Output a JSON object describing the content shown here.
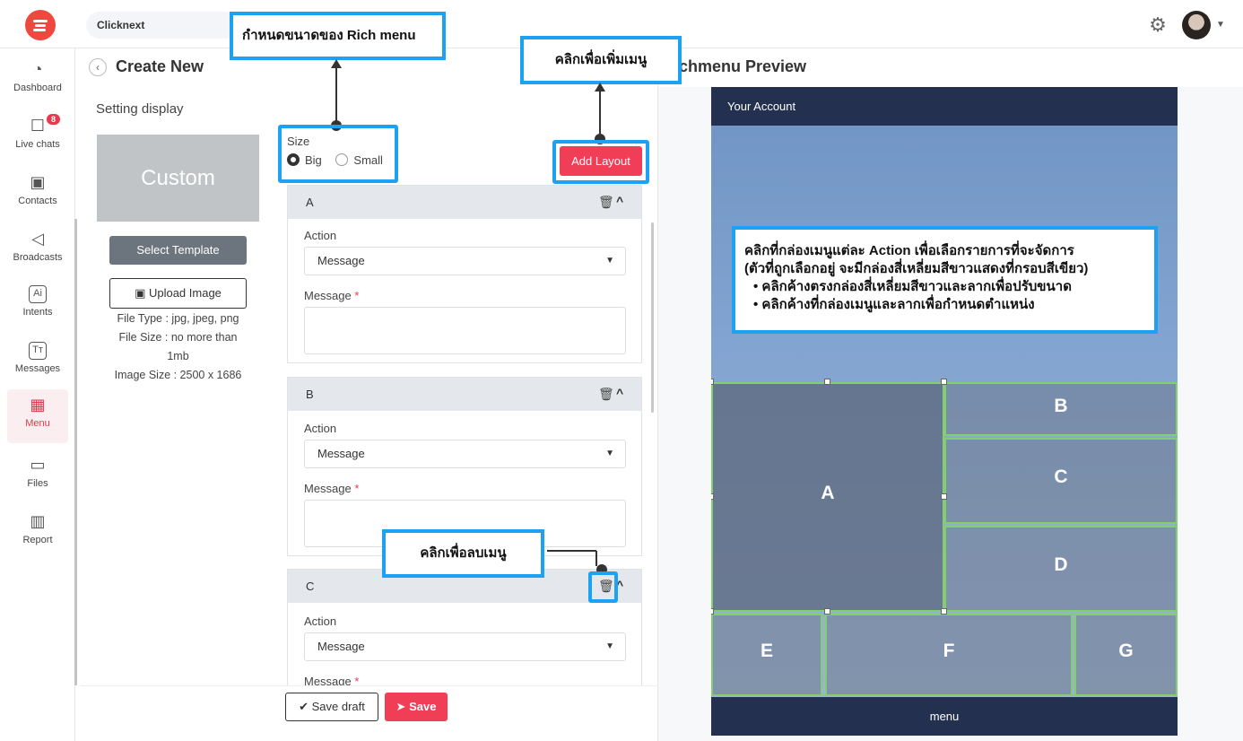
{
  "topbar": {
    "workspace": "Clicknext"
  },
  "sidebar": {
    "items": [
      {
        "label": "Dashboard",
        "icon": "pie-chart-icon"
      },
      {
        "label": "Live chats",
        "icon": "chat-icon",
        "badge": "8"
      },
      {
        "label": "Contacts",
        "icon": "contact-icon"
      },
      {
        "label": "Broadcasts",
        "icon": "megaphone-icon"
      },
      {
        "label": "Intents",
        "icon": "ai-icon"
      },
      {
        "label": "Messages",
        "icon": "text-icon"
      },
      {
        "label": "Menu",
        "icon": "grid-icon",
        "active": true
      },
      {
        "label": "Files",
        "icon": "folder-icon"
      },
      {
        "label": "Report",
        "icon": "report-icon"
      }
    ]
  },
  "editor": {
    "title": "Create New",
    "setting_display": "Setting display",
    "template_preview": "Custom",
    "select_template": "Select Template",
    "upload_image": "Upload Image",
    "file_type": "File Type : jpg, jpeg, png",
    "file_size": "File Size : no more than 1mb",
    "image_size": "Image Size : 2500 x 1686",
    "size_label": "Size",
    "size_options": [
      "Big",
      "Small"
    ],
    "size_selected": "Big",
    "add_layout": "Add Layout",
    "action_label": "Action",
    "message_label": "Message",
    "required_mark": "*",
    "panels": [
      {
        "name": "A",
        "action": "Message",
        "message": ""
      },
      {
        "name": "B",
        "action": "Message",
        "message": ""
      },
      {
        "name": "C",
        "action": "Message",
        "message": ""
      }
    ],
    "save_draft": "Save draft",
    "save": "Save"
  },
  "preview": {
    "title": "chmenu Preview",
    "header": "Your Account",
    "footer": "menu",
    "areas": [
      "A",
      "B",
      "C",
      "D",
      "E",
      "F",
      "G"
    ]
  },
  "annotations": {
    "size_callout": "กำหนดขนาดของ Rich menu",
    "add_callout": "คลิกเพื่อเพิ่มเมนู",
    "delete_callout": "คลิกเพื่อลบเมนู",
    "preview_callout_line1": "คลิกที่กล่องเมนูแต่ละ Action เพื่อเลือกรายการที่จะจัดการ",
    "preview_callout_line2": "(ตัวที่ถูกเลือกอยู่ จะมีกล่องสี่เหลี่ยมสีขาวแสดงที่กรอบสีเขียว)",
    "preview_callout_bullet1": "คลิกค้างตรงกล่องสี่เหลี่ยมสีขาวและลากเพื่อปรับขนาด",
    "preview_callout_bullet2": "คลิกค้างที่กล่องเมนูและลากเพื่อกำหนดตำแหน่ง"
  }
}
